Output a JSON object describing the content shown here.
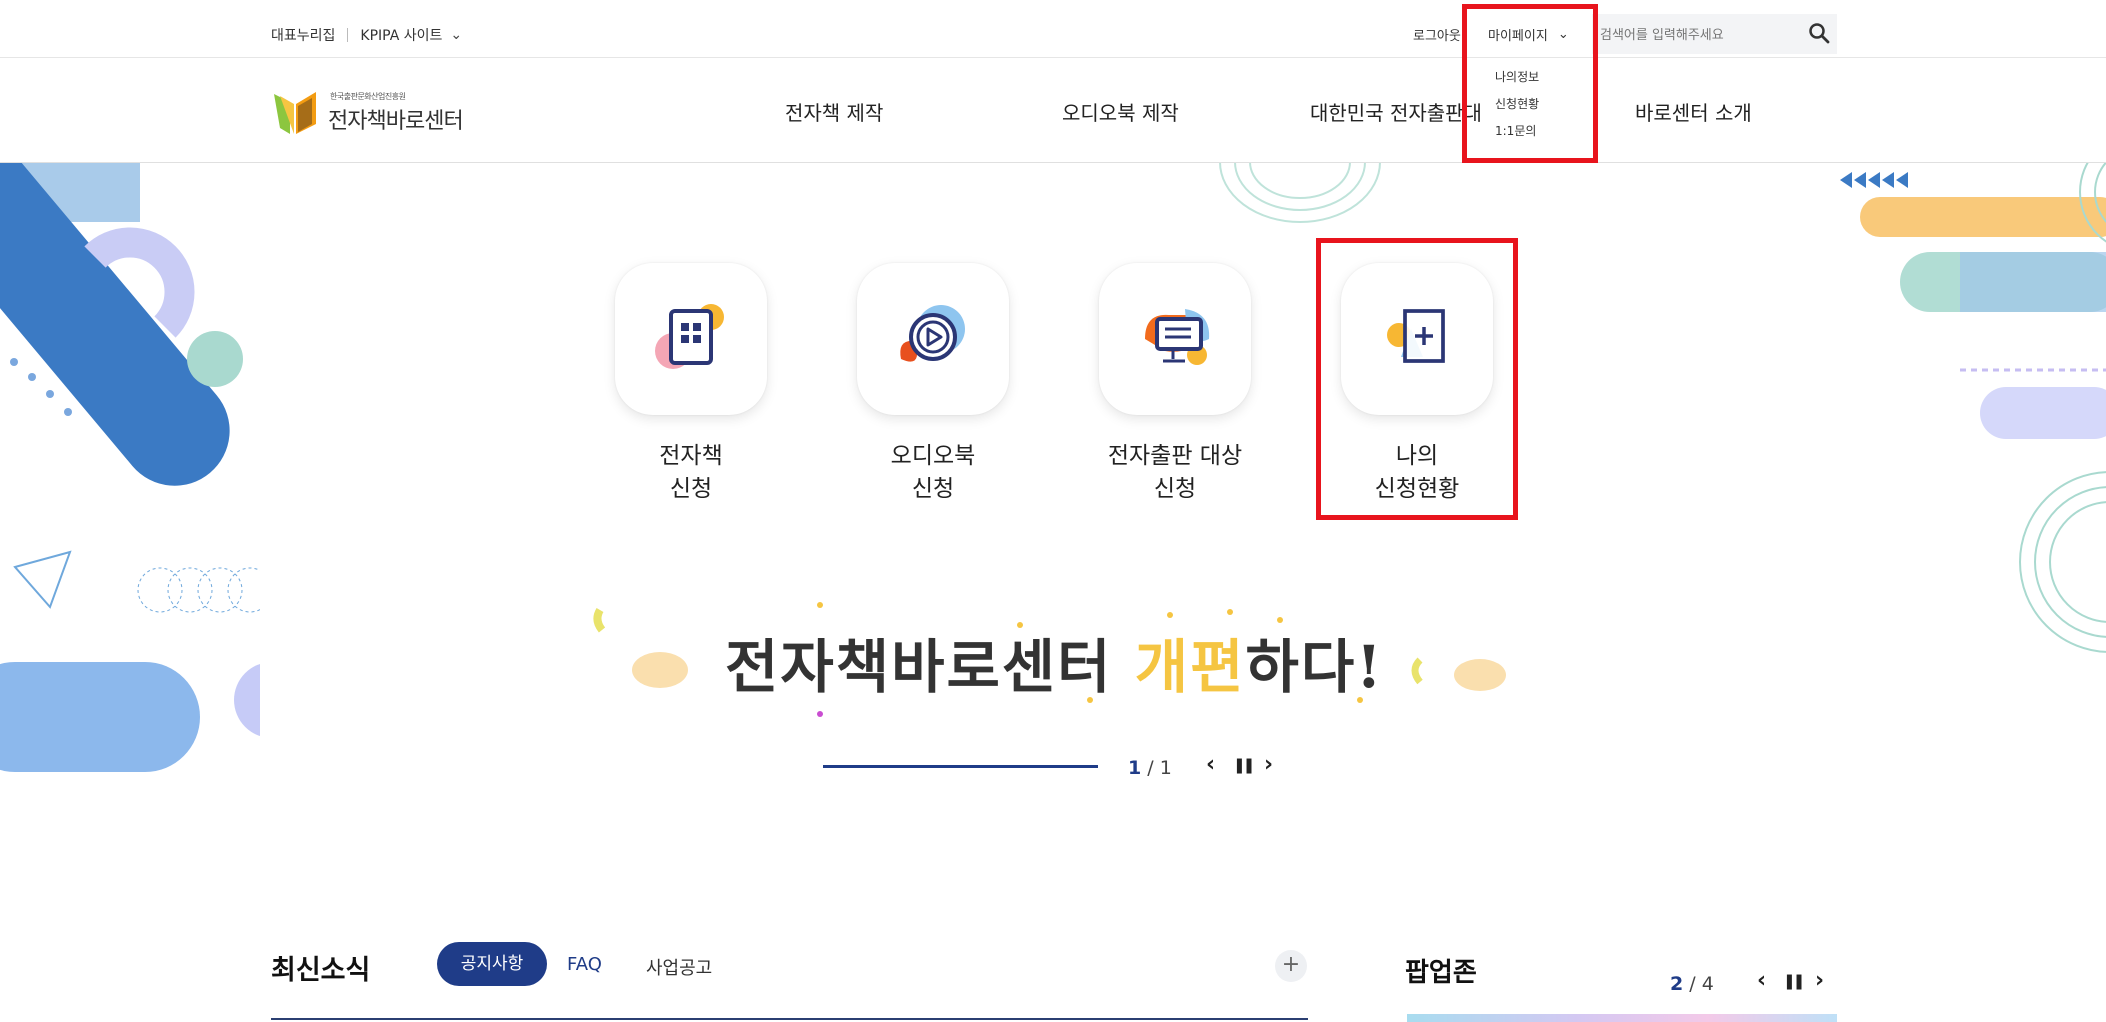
{
  "util": {
    "left_links": [
      "대표누리집",
      "KPIPA 사이트"
    ],
    "logout": "로그아웃",
    "mypage": "마이페이지",
    "search_placeholder": "검색어를 입력해주세요"
  },
  "mypage_menu": [
    "나의정보",
    "신청현황",
    "1:1문의"
  ],
  "logo": {
    "small": "한국출판문화산업진흥원",
    "big": "전자책바로센터"
  },
  "nav": [
    "전자책 제작",
    "오디오북 제작",
    "대한민국 전자출판대상",
    "바로센터 소개"
  ],
  "tiles": [
    {
      "line1": "전자책",
      "line2": "신청",
      "icon": "ebook-grid-icon"
    },
    {
      "line1": "오디오북",
      "line2": "신청",
      "icon": "play-circle-icon"
    },
    {
      "line1": "전자출판 대상",
      "line2": "신청",
      "icon": "monitor-icon"
    },
    {
      "line1": "나의",
      "line2": "신청현황",
      "icon": "document-plus-icon"
    }
  ],
  "banner": {
    "title_part1": "전자책바로센터 ",
    "title_accent": "개편",
    "title_part2": "하다!",
    "current": "1",
    "total": "/ 1"
  },
  "news": {
    "title": "최신소식",
    "tabs": [
      "공지사항",
      "FAQ",
      "사업공고"
    ],
    "more": "+"
  },
  "popup": {
    "title": "팝업존",
    "current": "2",
    "total": "/ 4"
  },
  "controls": {
    "prev": "‹",
    "pause": "❚❚",
    "next": "›"
  },
  "colors": {
    "primary": "#1f3c88",
    "highlight": "#e8141d",
    "accent": "#f5c542"
  }
}
